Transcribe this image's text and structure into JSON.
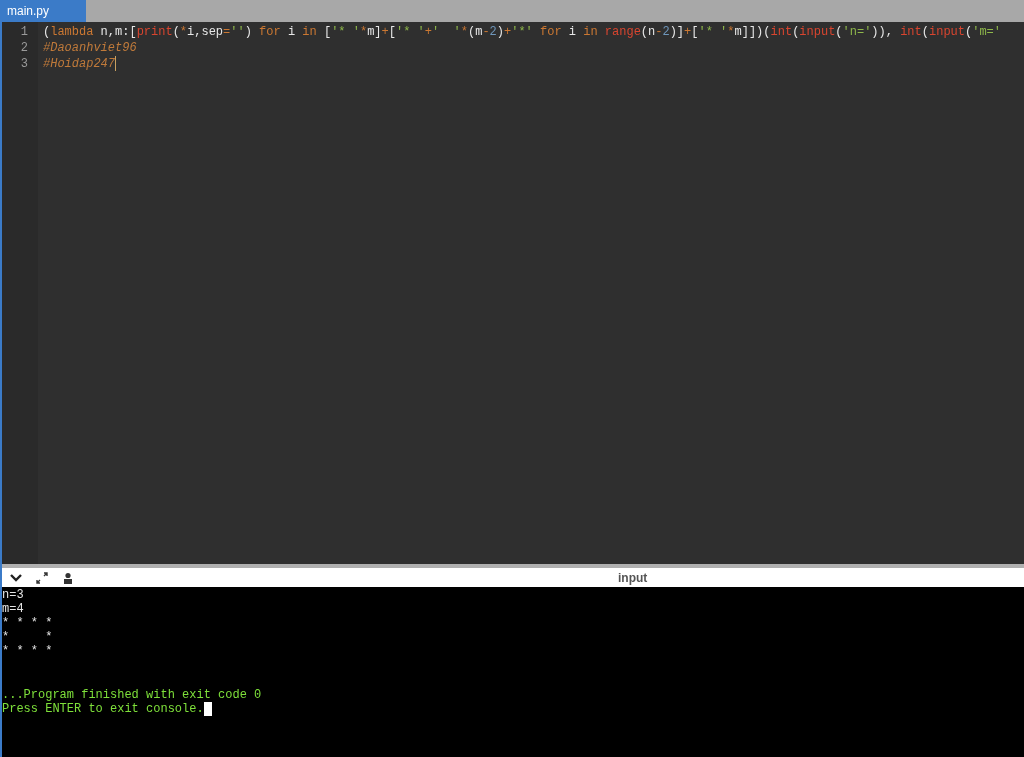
{
  "tabs": [
    {
      "label": "main.py",
      "selected": true
    }
  ],
  "editor": {
    "lines": [
      {
        "number": "1",
        "tokens": [
          {
            "text": "(",
            "kind": "plain"
          },
          {
            "text": "lambda",
            "kind": "keyword"
          },
          {
            "text": " n,m:[",
            "kind": "plain"
          },
          {
            "text": "print",
            "kind": "builtin"
          },
          {
            "text": "(",
            "kind": "plain"
          },
          {
            "text": "*",
            "kind": "operator"
          },
          {
            "text": "i,sep",
            "kind": "plain"
          },
          {
            "text": "=",
            "kind": "operator"
          },
          {
            "text": "''",
            "kind": "string"
          },
          {
            "text": ") ",
            "kind": "plain"
          },
          {
            "text": "for",
            "kind": "keyword"
          },
          {
            "text": " i ",
            "kind": "plain"
          },
          {
            "text": "in",
            "kind": "keyword"
          },
          {
            "text": " [",
            "kind": "plain"
          },
          {
            "text": "'* '",
            "kind": "string"
          },
          {
            "text": "*",
            "kind": "operator"
          },
          {
            "text": "m]",
            "kind": "plain"
          },
          {
            "text": "+",
            "kind": "operator"
          },
          {
            "text": "[",
            "kind": "plain"
          },
          {
            "text": "'* '",
            "kind": "string"
          },
          {
            "text": "+",
            "kind": "operator"
          },
          {
            "text": "'  '",
            "kind": "string"
          },
          {
            "text": "*",
            "kind": "operator"
          },
          {
            "text": "(m",
            "kind": "plain"
          },
          {
            "text": "-",
            "kind": "operator"
          },
          {
            "text": "2",
            "kind": "number"
          },
          {
            "text": ")",
            "kind": "plain"
          },
          {
            "text": "+",
            "kind": "operator"
          },
          {
            "text": "'*'",
            "kind": "string"
          },
          {
            "text": " for",
            "kind": "keyword"
          },
          {
            "text": " i ",
            "kind": "plain"
          },
          {
            "text": "in",
            "kind": "keyword"
          },
          {
            "text": " range",
            "kind": "builtin"
          },
          {
            "text": "(n",
            "kind": "plain"
          },
          {
            "text": "-",
            "kind": "operator"
          },
          {
            "text": "2",
            "kind": "number"
          },
          {
            "text": ")]",
            "kind": "plain"
          },
          {
            "text": "+",
            "kind": "operator"
          },
          {
            "text": "[",
            "kind": "plain"
          },
          {
            "text": "'* '",
            "kind": "string"
          },
          {
            "text": "*",
            "kind": "operator"
          },
          {
            "text": "m]])(",
            "kind": "plain"
          },
          {
            "text": "int",
            "kind": "builtin"
          },
          {
            "text": "(",
            "kind": "plain"
          },
          {
            "text": "input",
            "kind": "builtin"
          },
          {
            "text": "(",
            "kind": "plain"
          },
          {
            "text": "'n='",
            "kind": "string"
          },
          {
            "text": ")), ",
            "kind": "plain"
          },
          {
            "text": "int",
            "kind": "builtin"
          },
          {
            "text": "(",
            "kind": "plain"
          },
          {
            "text": "input",
            "kind": "builtin"
          },
          {
            "text": "(",
            "kind": "plain"
          },
          {
            "text": "'m='",
            "kind": "string"
          }
        ]
      },
      {
        "number": "2",
        "tokens": [
          {
            "text": "#Daoanhviet96",
            "kind": "comment"
          }
        ]
      },
      {
        "number": "3",
        "tokens": [
          {
            "text": "#Hoidap247",
            "kind": "comment"
          }
        ]
      }
    ]
  },
  "console": {
    "title": "input",
    "output": [
      "n=3",
      "m=4",
      "* * * *",
      "*     *",
      "* * * *"
    ],
    "status": [
      "...Program finished with exit code 0",
      "Press ENTER to exit console."
    ]
  }
}
